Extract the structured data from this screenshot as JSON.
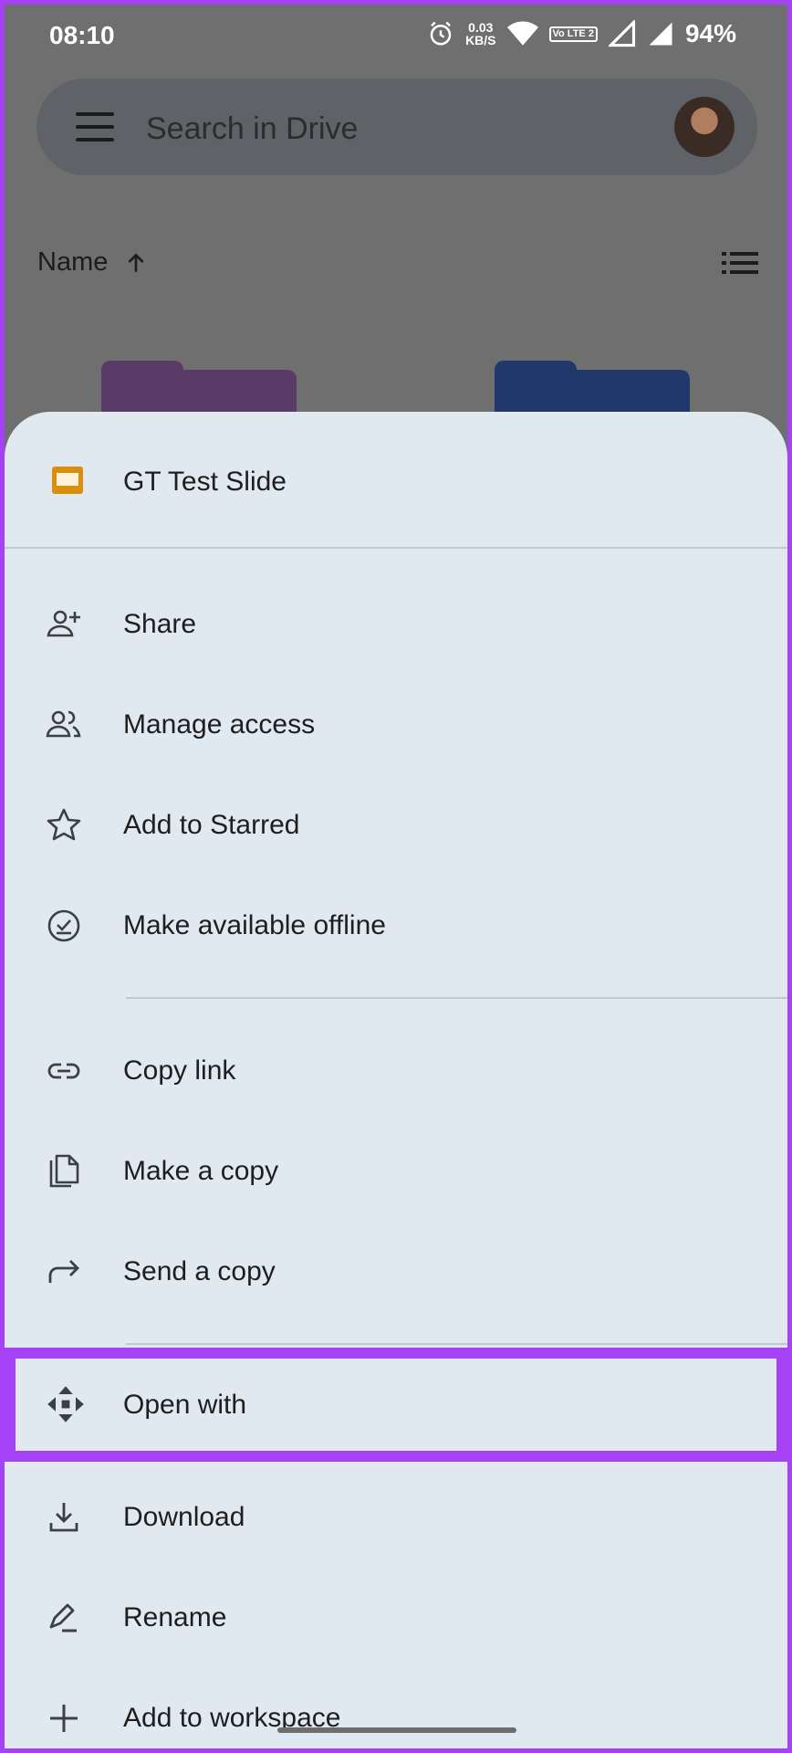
{
  "status_bar": {
    "time": "08:10",
    "net_speed_value": "0.03",
    "net_speed_unit": "KB/S",
    "volte_label": "Vo LTE 2",
    "battery": "94%"
  },
  "search": {
    "placeholder": "Search in Drive"
  },
  "sort": {
    "label": "Name",
    "direction_icon": "arrow-up-icon"
  },
  "sheet": {
    "file_name": "GT Test Slide",
    "file_icon": "slides-icon",
    "items": [
      {
        "label": "Share",
        "icon": "person-add-icon"
      },
      {
        "label": "Manage access",
        "icon": "people-icon"
      },
      {
        "label": "Add to Starred",
        "icon": "star-icon"
      },
      {
        "label": "Make available offline",
        "icon": "offline-check-icon"
      },
      {
        "label": "Copy link",
        "icon": "link-icon"
      },
      {
        "label": "Make a copy",
        "icon": "copy-icon"
      },
      {
        "label": "Send a copy",
        "icon": "forward-arrow-icon"
      },
      {
        "label": "Open with",
        "icon": "open-with-icon"
      },
      {
        "label": "Download",
        "icon": "download-icon"
      },
      {
        "label": "Rename",
        "icon": "rename-pencil-icon"
      },
      {
        "label": "Add to workspace",
        "icon": "plus-icon"
      }
    ]
  },
  "colors": {
    "highlight": "#a542f5",
    "sheet_bg": "#e0e9f0",
    "slides_icon": "#d98e0e"
  }
}
